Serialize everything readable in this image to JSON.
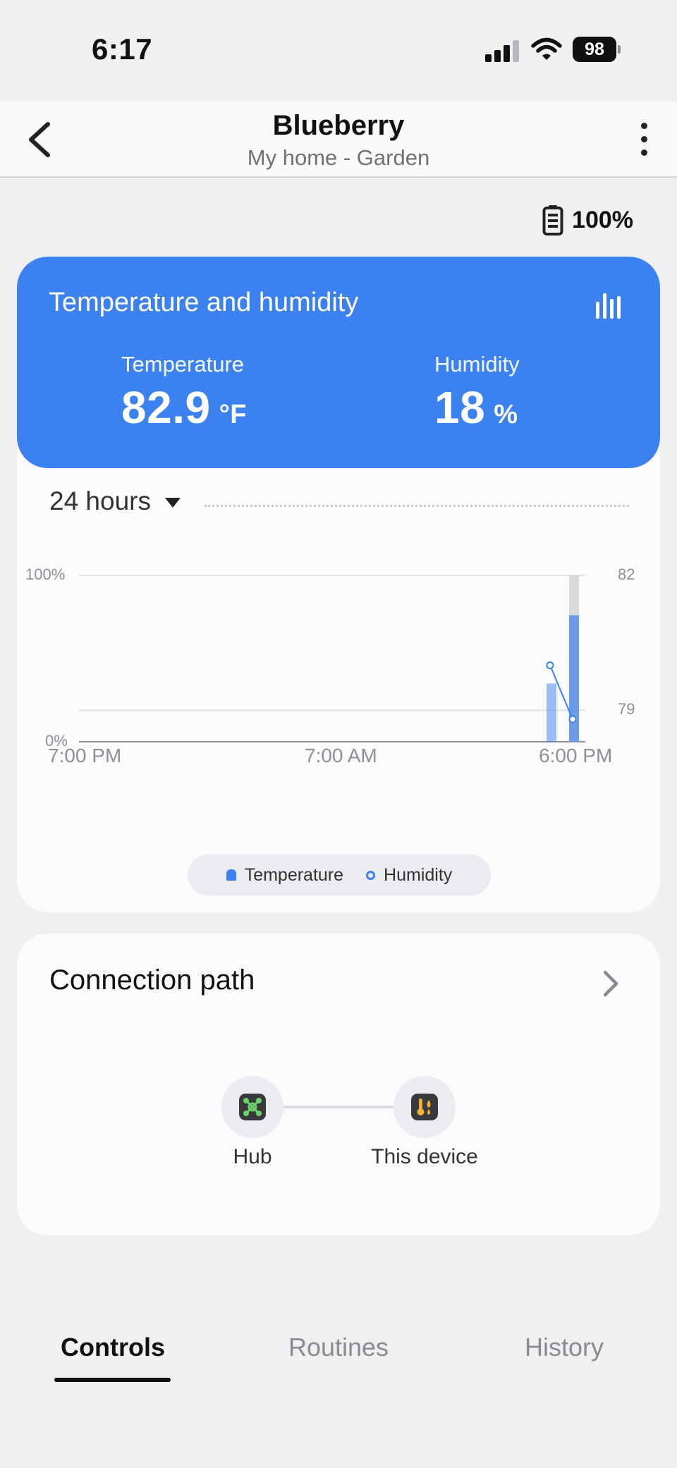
{
  "status_bar": {
    "time": "6:17",
    "battery": "98"
  },
  "header": {
    "title": "Blueberry",
    "subtitle": "My home - Garden"
  },
  "device_battery": {
    "label": "100%"
  },
  "climate_card": {
    "title": "Temperature and humidity",
    "temperature": {
      "label": "Temperature",
      "value": "82.9",
      "unit": "°F"
    },
    "humidity": {
      "label": "Humidity",
      "value": "18",
      "unit": "%"
    },
    "range": "24 hours"
  },
  "chart_data": {
    "type": "bar",
    "x_ticks": [
      "7:00 PM",
      "7:00 AM",
      "6:00 PM"
    ],
    "y_left_ticks": [
      "100%",
      "0%"
    ],
    "y_right_ticks": [
      "82",
      "79"
    ],
    "series": [
      {
        "name": "Temperature",
        "kind": "bar",
        "x": [
          "5:00 PM",
          "6:00 PM"
        ],
        "values": [
          35,
          76
        ],
        "max_values": [
          null,
          100
        ]
      },
      {
        "name": "Humidity",
        "kind": "line",
        "x": [
          "5:00 PM",
          "6:00 PM"
        ],
        "values": [
          80,
          78.8
        ]
      }
    ],
    "ylim_left": [
      0,
      100
    ],
    "ylim_right": [
      78.3,
      82
    ],
    "legend": "bottom",
    "colors": {
      "temperature": "#3b82f0",
      "humidity": "#3b82f0",
      "range": "#d9d9dc"
    },
    "grid": true
  },
  "legend": {
    "temperature": "Temperature",
    "humidity": "Humidity"
  },
  "connection_path": {
    "title": "Connection path",
    "nodes": [
      {
        "label": "Hub",
        "icon": "hub-icon"
      },
      {
        "label": "This device",
        "icon": "thermometer-icon"
      }
    ]
  },
  "tabs": [
    {
      "label": "Controls",
      "active": true
    },
    {
      "label": "Routines",
      "active": false
    },
    {
      "label": "History",
      "active": false
    }
  ],
  "colors": {
    "accent": "#3b82f0",
    "background": "#f0f0f3",
    "card": "#fbfbfd"
  }
}
